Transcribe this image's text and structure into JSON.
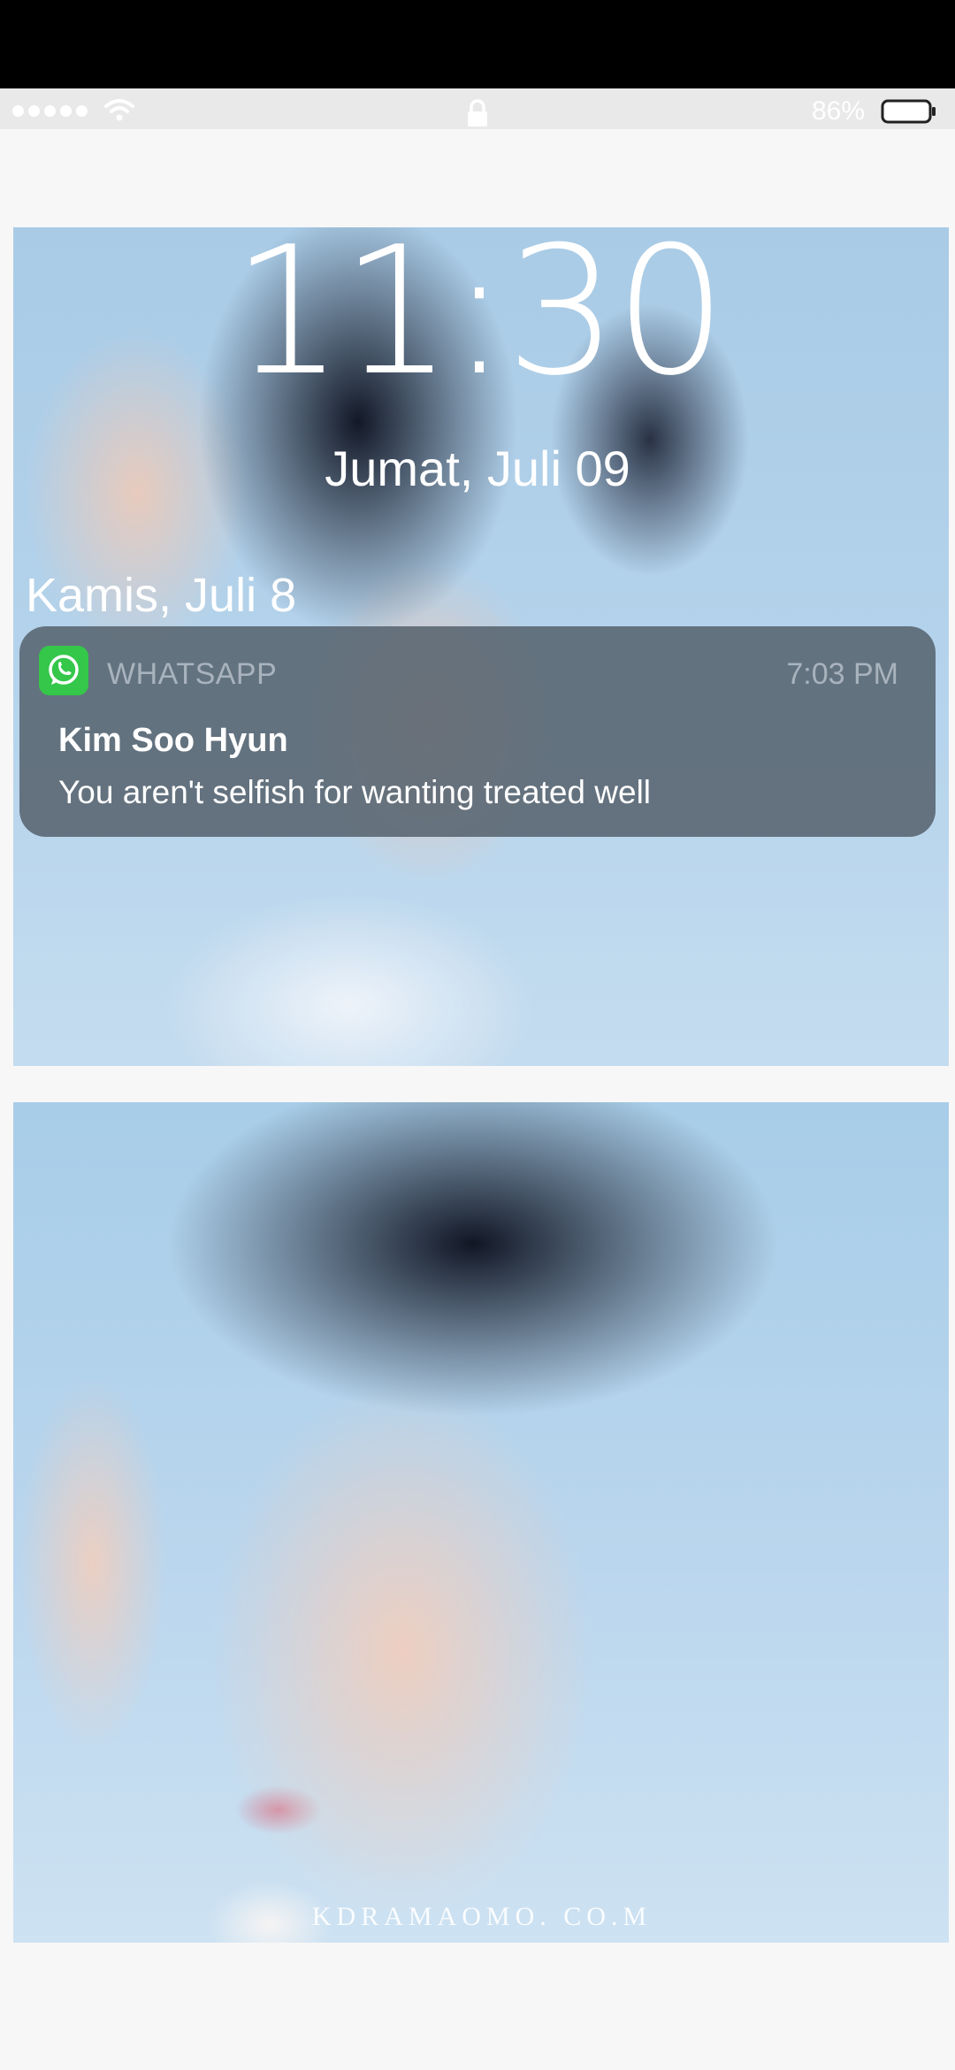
{
  "status_bar": {
    "signal": "signal-dots-icon",
    "wifi": "wifi-icon",
    "lock": "lock-icon",
    "battery_percent": "86%",
    "battery": "battery-icon"
  },
  "lock_screen": {
    "time": "11:30",
    "date": "Jumat, Juli 09",
    "section_date": "Kamis, Juli 8"
  },
  "notification": {
    "app_icon": "whatsapp-icon",
    "app_name": "WHATSAPP",
    "time": "7:03 PM",
    "title": "Kim Soo Hyun",
    "body": "You aren't selfish for wanting treated well",
    "app_color": "#35c74a"
  },
  "wallpaper": {
    "watermark": "KDRAMAOMO. CO.M"
  }
}
